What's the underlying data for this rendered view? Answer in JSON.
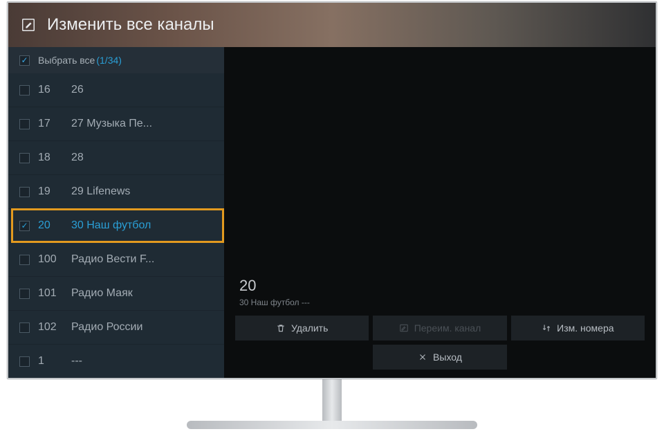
{
  "header": {
    "title": "Изменить все каналы",
    "icon": "edit-icon"
  },
  "selectAll": {
    "label": "Выбрать все",
    "count": "(1/34)"
  },
  "channels": [
    {
      "num": "16",
      "name": "26",
      "checked": false,
      "selected": false
    },
    {
      "num": "17",
      "name": "27 Музыка Пе...",
      "checked": false,
      "selected": false
    },
    {
      "num": "18",
      "name": "28",
      "checked": false,
      "selected": false
    },
    {
      "num": "19",
      "name": "29 Lifenews",
      "checked": false,
      "selected": false
    },
    {
      "num": "20",
      "name": "30 Наш футбол",
      "checked": true,
      "selected": true
    },
    {
      "num": "100",
      "name": "Радио Вести F...",
      "checked": false,
      "selected": false
    },
    {
      "num": "101",
      "name": "Радио Маяк",
      "checked": false,
      "selected": false
    },
    {
      "num": "102",
      "name": "Радио России",
      "checked": false,
      "selected": false
    },
    {
      "num": "1",
      "name": "---",
      "checked": false,
      "selected": false
    }
  ],
  "detail": {
    "number": "20",
    "line": "30 Наш футбол ---"
  },
  "actions": {
    "delete": "Удалить",
    "rename": "Переим. канал",
    "renumber": "Изм. номера",
    "exit": "Выход"
  }
}
